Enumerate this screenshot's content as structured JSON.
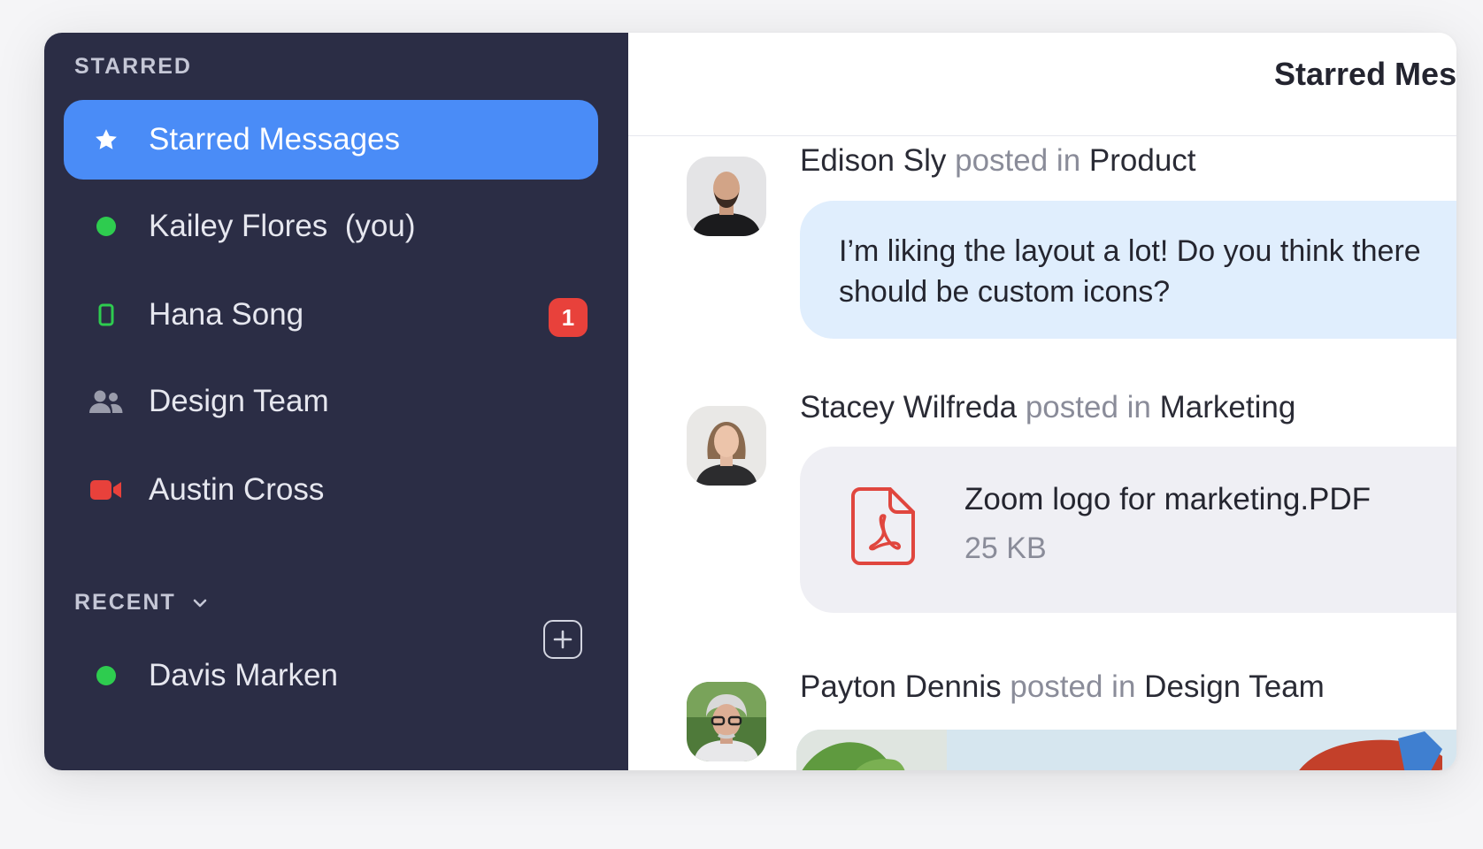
{
  "sidebar": {
    "starred_label": "STARRED",
    "items": [
      {
        "label": "Starred Messages",
        "icon": "star-icon"
      },
      {
        "label": "Kailey Flores  (you)",
        "icon": "online-status-icon"
      },
      {
        "label": "Hana Song",
        "icon": "mobile-status-icon",
        "badge": "1"
      },
      {
        "label": "Design Team",
        "icon": "group-icon"
      },
      {
        "label": "Austin Cross",
        "icon": "video-call-icon"
      }
    ],
    "recent_label": "RECENT",
    "recent_items": [
      {
        "label": "Davis Marken",
        "icon": "online-status-icon"
      }
    ]
  },
  "main": {
    "title": "Starred Messages",
    "posted_in": "posted in",
    "posts": [
      {
        "author": "Edison Sly",
        "channel": "Product",
        "message": "I’m liking the layout a lot! Do you think there should be custom icons?"
      },
      {
        "author": "Stacey Wilfreda",
        "channel": "Marketing",
        "file_name": "Zoom logo for marketing.PDF",
        "file_size": "25 KB"
      },
      {
        "author": "Payton Dennis",
        "channel": "Design Team"
      }
    ]
  },
  "colors": {
    "sidebar_bg": "#2b2d45",
    "active_item": "#4a8cf7",
    "online": "#2ecc4f",
    "badge": "#e8413b",
    "message_bubble": "#e0eefd",
    "file_card": "#efeff4",
    "pdf_red": "#e0463e"
  }
}
